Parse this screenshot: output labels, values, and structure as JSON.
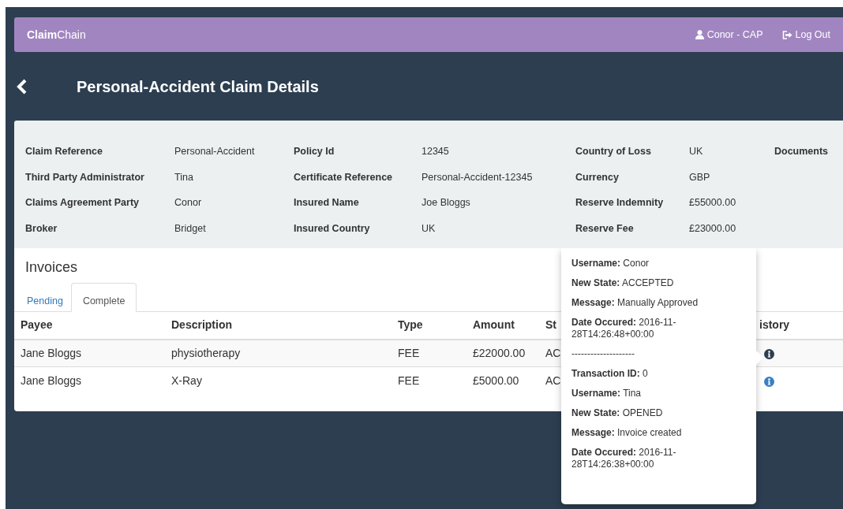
{
  "navbar": {
    "brand": "**Claim**Chain",
    "user": "Conor - CAP",
    "logout": "Log Out"
  },
  "page": {
    "title": "Personal-Accident Claim Details"
  },
  "details": {
    "rows": [
      [
        {
          "label": "Claim Reference",
          "value": "Personal-Accident"
        },
        {
          "label": "Policy Id",
          "value": "12345"
        },
        {
          "label": "Country of Loss",
          "value": "UK"
        },
        {
          "label": "Documents"
        }
      ],
      [
        {
          "label": "Third Party Administrator",
          "value": "Tina"
        },
        {
          "label": "Certificate Reference",
          "value": "Personal-Accident-12345"
        },
        {
          "label": "Currency",
          "value": "GBP"
        }
      ],
      [
        {
          "label": "Claims Agreement Party",
          "value": "Conor"
        },
        {
          "label": "Insured Name",
          "value": "Joe Bloggs"
        },
        {
          "label": "Reserve Indemnity",
          "value": "£55000.00"
        }
      ],
      [
        {
          "label": "Broker",
          "value": "Bridget"
        },
        {
          "label": "Insured Country",
          "value": "UK"
        },
        {
          "label": "Reserve Fee",
          "value": "£23000.00"
        }
      ]
    ]
  },
  "invoices": {
    "title": "Invoices",
    "tabs": [
      {
        "label": "Pending",
        "selected": false
      },
      {
        "label": "Complete",
        "selected": true
      }
    ],
    "table": {
      "columns": [
        "Payee",
        "Description",
        "Type",
        "Amount",
        "St",
        "istory"
      ],
      "rows": [
        {
          "cells": [
            "Jane Bloggs",
            "physiotherapy",
            "FEE",
            "£22000.00",
            "AC"
          ],
          "history_active": true
        },
        {
          "cells": [
            "Jane Bloggs",
            "X-Ray",
            "FEE",
            "£5000.00",
            "AC"
          ],
          "history_active": false
        }
      ]
    }
  },
  "popover": {
    "entries": [
      {
        "kind": "field",
        "label": "Username:",
        "value": "Conor"
      },
      {
        "kind": "field",
        "label": "New State:",
        "value": "ACCEPTED"
      },
      {
        "kind": "field",
        "label": "Message:",
        "value": "Manually Approved"
      },
      {
        "kind": "field",
        "label": "Date Occured:",
        "value": "2016-11-28T14:26:48+00:00"
      },
      {
        "kind": "separator",
        "text": "--------------------"
      },
      {
        "kind": "field",
        "label": "Transaction ID:",
        "value": "0"
      },
      {
        "kind": "field",
        "label": "Username:",
        "value": "Tina"
      },
      {
        "kind": "field",
        "label": "New State:",
        "value": "OPENED"
      },
      {
        "kind": "field",
        "label": "Message:",
        "value": "Invoice created"
      },
      {
        "kind": "field",
        "label": "Date Occured:",
        "value": "2016-11-28T14:26:38+00:00"
      }
    ]
  }
}
